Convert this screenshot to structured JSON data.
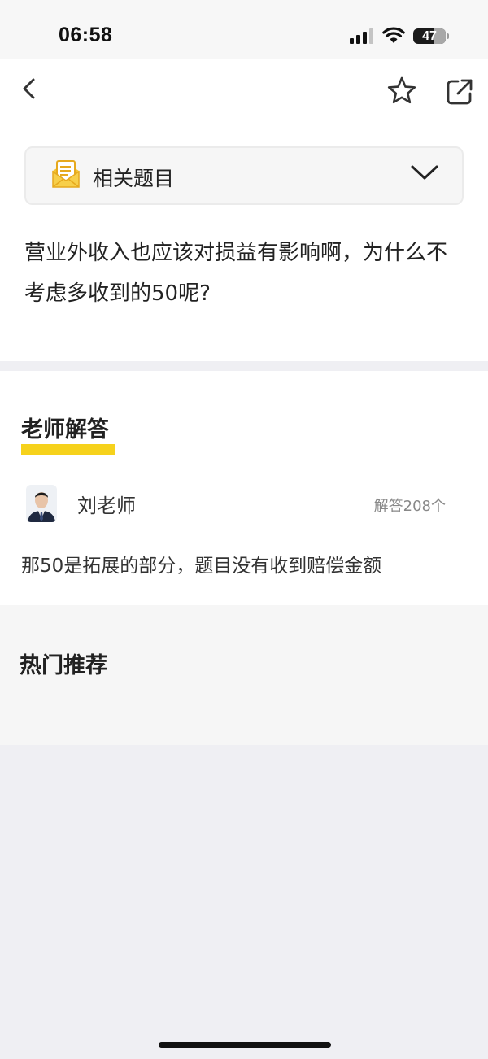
{
  "status_bar": {
    "time": "06:58",
    "battery_level": "47"
  },
  "nav": {
    "back_icon": "chevron-left-icon",
    "favorite_icon": "star-icon",
    "share_icon": "share-external-icon"
  },
  "related": {
    "label": "相关题目",
    "icon": "envelope-document-icon",
    "expand_icon": "chevron-down-icon"
  },
  "question": {
    "text": "营业外收入也应该对损益有影响啊，为什么不考虑多收到的50呢?"
  },
  "answer": {
    "heading": "老师解答",
    "teacher_name": "刘老师",
    "answer_count": "解答208个",
    "text": "那50是拓展的部分，题目没有收到赔偿金额"
  },
  "hot": {
    "title": "热门推荐"
  },
  "colors": {
    "accent_yellow": "#f6d21c",
    "page_background": "#efeff3"
  }
}
